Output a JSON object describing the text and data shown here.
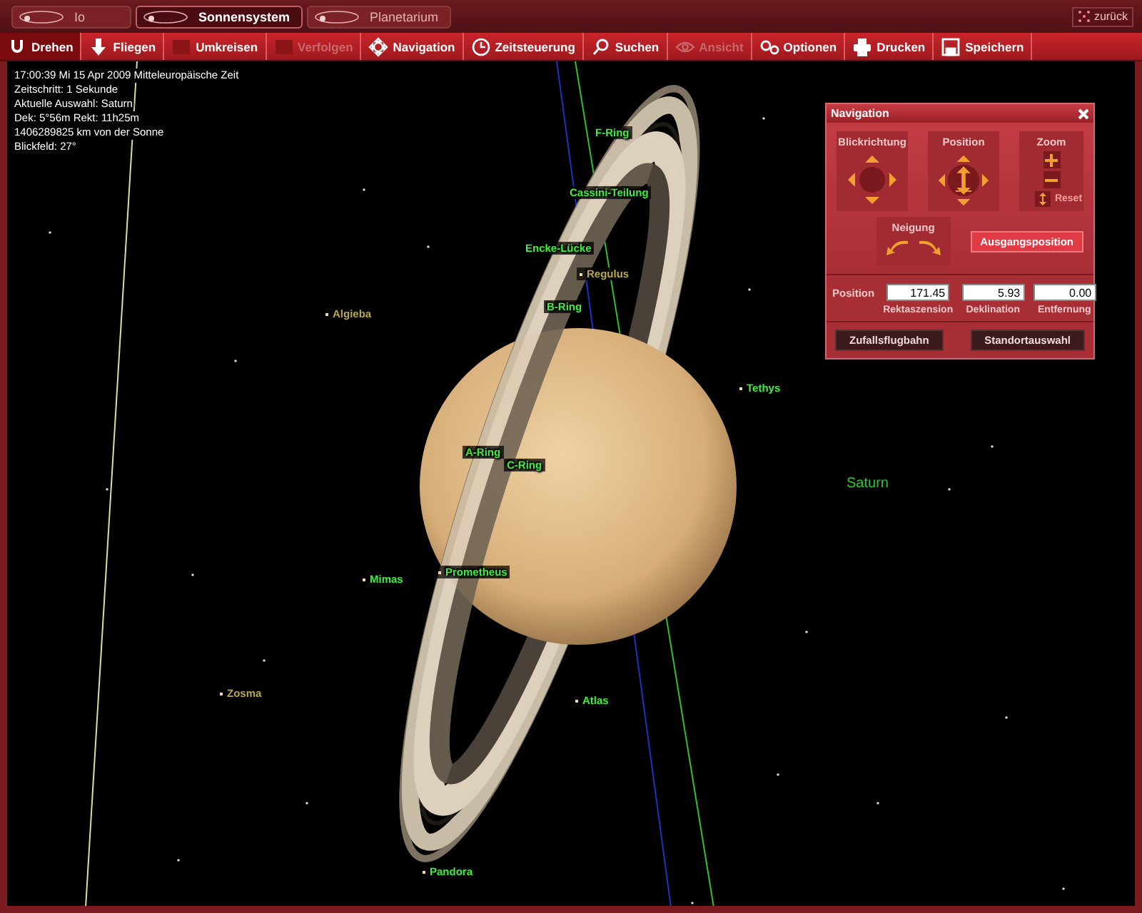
{
  "tabs": [
    {
      "label": "Io",
      "selected": false
    },
    {
      "label": "Sonnensystem",
      "selected": true
    },
    {
      "label": "Planetarium",
      "selected": false
    }
  ],
  "back_button": "zurück",
  "toolbar": [
    {
      "label": "Drehen",
      "selected": true,
      "disabled": false
    },
    {
      "label": "Fliegen",
      "selected": false,
      "disabled": false
    },
    {
      "label": "Umkreisen",
      "selected": false,
      "disabled": false
    },
    {
      "label": "Verfolgen",
      "selected": false,
      "disabled": true
    },
    {
      "label": "Navigation",
      "selected": false,
      "disabled": false
    },
    {
      "label": "Zeitsteuerung",
      "selected": false,
      "disabled": false
    },
    {
      "label": "Suchen",
      "selected": false,
      "disabled": false
    },
    {
      "label": "Ansicht",
      "selected": false,
      "disabled": true
    },
    {
      "label": "Optionen",
      "selected": false,
      "disabled": false
    },
    {
      "label": "Drucken",
      "selected": false,
      "disabled": false
    },
    {
      "label": "Speichern",
      "selected": false,
      "disabled": false
    }
  ],
  "info_lines": [
    "17:00:39 Mi   15 Apr  2009 Mitteleuropäische Zeit",
    "Zeitschritt: 1 Sekunde",
    "Aktuelle Auswahl: Saturn",
    "Dek: 5°56m Rekt: 11h25m",
    "1406289825 km von der Sonne",
    "Blickfeld: 27°"
  ],
  "sky_labels": [
    {
      "text": "F-Ring",
      "kind": "ring"
    },
    {
      "text": "Cassini-Teilung",
      "kind": "ring"
    },
    {
      "text": "Encke-Lücke",
      "kind": "ring"
    },
    {
      "text": "Regulus",
      "kind": "star"
    },
    {
      "text": "B-Ring",
      "kind": "ring"
    },
    {
      "text": "Algieba",
      "kind": "star"
    },
    {
      "text": "Tethys",
      "kind": "moon"
    },
    {
      "text": "A-Ring",
      "kind": "ring"
    },
    {
      "text": "C-Ring",
      "kind": "ring"
    },
    {
      "text": "Saturn",
      "kind": "planet"
    },
    {
      "text": "Mimas",
      "kind": "moon"
    },
    {
      "text": "Prometheus",
      "kind": "moon"
    },
    {
      "text": "Zosma",
      "kind": "star"
    },
    {
      "text": "Atlas",
      "kind": "moon"
    },
    {
      "text": "Pandora",
      "kind": "moon"
    }
  ],
  "navigation": {
    "title": "Navigation",
    "view_direction": "Blickrichtung",
    "position": "Position",
    "zoom": "Zoom",
    "reset": "Reset",
    "tilt": "Neigung",
    "home_button": "Ausgangsposition",
    "position_label": "Position",
    "fields": [
      {
        "value": "171.45",
        "caption": "Rektaszension"
      },
      {
        "value": "5.93",
        "caption": "Deklination"
      },
      {
        "value": "0.00",
        "caption": "Entfernung"
      }
    ],
    "buttons": [
      "Zufallsflugbahn",
      "Standortauswahl"
    ]
  }
}
